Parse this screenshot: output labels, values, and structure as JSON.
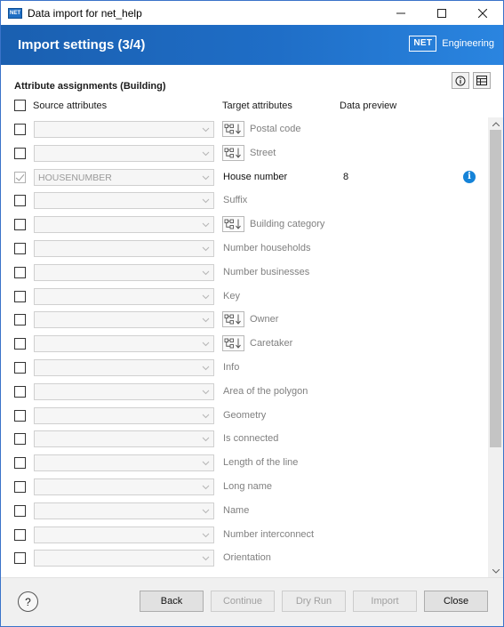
{
  "window": {
    "app_icon_text": "NET",
    "title": "Data import for net_help"
  },
  "banner": {
    "title": "Import settings (3/4)",
    "brand_box": "NET",
    "brand_text": "Engineering"
  },
  "section": {
    "title": "Attribute assignments (Building)"
  },
  "columns": {
    "source": "Source attributes",
    "target": "Target attributes",
    "preview": "Data preview"
  },
  "rows": [
    {
      "source": "",
      "target": "Postal code",
      "checked": false,
      "relation": true,
      "preview": "",
      "info": false,
      "active": false
    },
    {
      "source": "",
      "target": "Street",
      "checked": false,
      "relation": true,
      "preview": "",
      "info": false,
      "active": false
    },
    {
      "source": "HOUSENUMBER",
      "target": "House number",
      "checked": true,
      "relation": false,
      "preview": "8",
      "info": true,
      "active": true
    },
    {
      "source": "",
      "target": "Suffix",
      "checked": false,
      "relation": false,
      "preview": "",
      "info": false,
      "active": false
    },
    {
      "source": "",
      "target": "Building category",
      "checked": false,
      "relation": true,
      "preview": "",
      "info": false,
      "active": false
    },
    {
      "source": "",
      "target": "Number households",
      "checked": false,
      "relation": false,
      "preview": "",
      "info": false,
      "active": false
    },
    {
      "source": "",
      "target": "Number businesses",
      "checked": false,
      "relation": false,
      "preview": "",
      "info": false,
      "active": false
    },
    {
      "source": "",
      "target": "Key",
      "checked": false,
      "relation": false,
      "preview": "",
      "info": false,
      "active": false
    },
    {
      "source": "",
      "target": "Owner",
      "checked": false,
      "relation": true,
      "preview": "",
      "info": false,
      "active": false
    },
    {
      "source": "",
      "target": "Caretaker",
      "checked": false,
      "relation": true,
      "preview": "",
      "info": false,
      "active": false
    },
    {
      "source": "",
      "target": "Info",
      "checked": false,
      "relation": false,
      "preview": "",
      "info": false,
      "active": false
    },
    {
      "source": "",
      "target": "Area of the polygon",
      "checked": false,
      "relation": false,
      "preview": "",
      "info": false,
      "active": false
    },
    {
      "source": "",
      "target": "Geometry",
      "checked": false,
      "relation": false,
      "preview": "",
      "info": false,
      "active": false
    },
    {
      "source": "",
      "target": "Is connected",
      "checked": false,
      "relation": false,
      "preview": "",
      "info": false,
      "active": false
    },
    {
      "source": "",
      "target": "Length of the line",
      "checked": false,
      "relation": false,
      "preview": "",
      "info": false,
      "active": false
    },
    {
      "source": "",
      "target": "Long name",
      "checked": false,
      "relation": false,
      "preview": "",
      "info": false,
      "active": false
    },
    {
      "source": "",
      "target": "Name",
      "checked": false,
      "relation": false,
      "preview": "",
      "info": false,
      "active": false
    },
    {
      "source": "",
      "target": "Number interconnect",
      "checked": false,
      "relation": false,
      "preview": "",
      "info": false,
      "active": false
    },
    {
      "source": "",
      "target": "Orientation",
      "checked": false,
      "relation": false,
      "preview": "",
      "info": false,
      "active": false
    }
  ],
  "info_icon_glyph": "i",
  "footer": {
    "help": "?",
    "back": "Back",
    "continue": "Continue",
    "dry_run": "Dry Run",
    "import": "Import",
    "close": "Close"
  },
  "colors": {
    "banner": "#1f6ec7",
    "info": "#1583d8"
  }
}
